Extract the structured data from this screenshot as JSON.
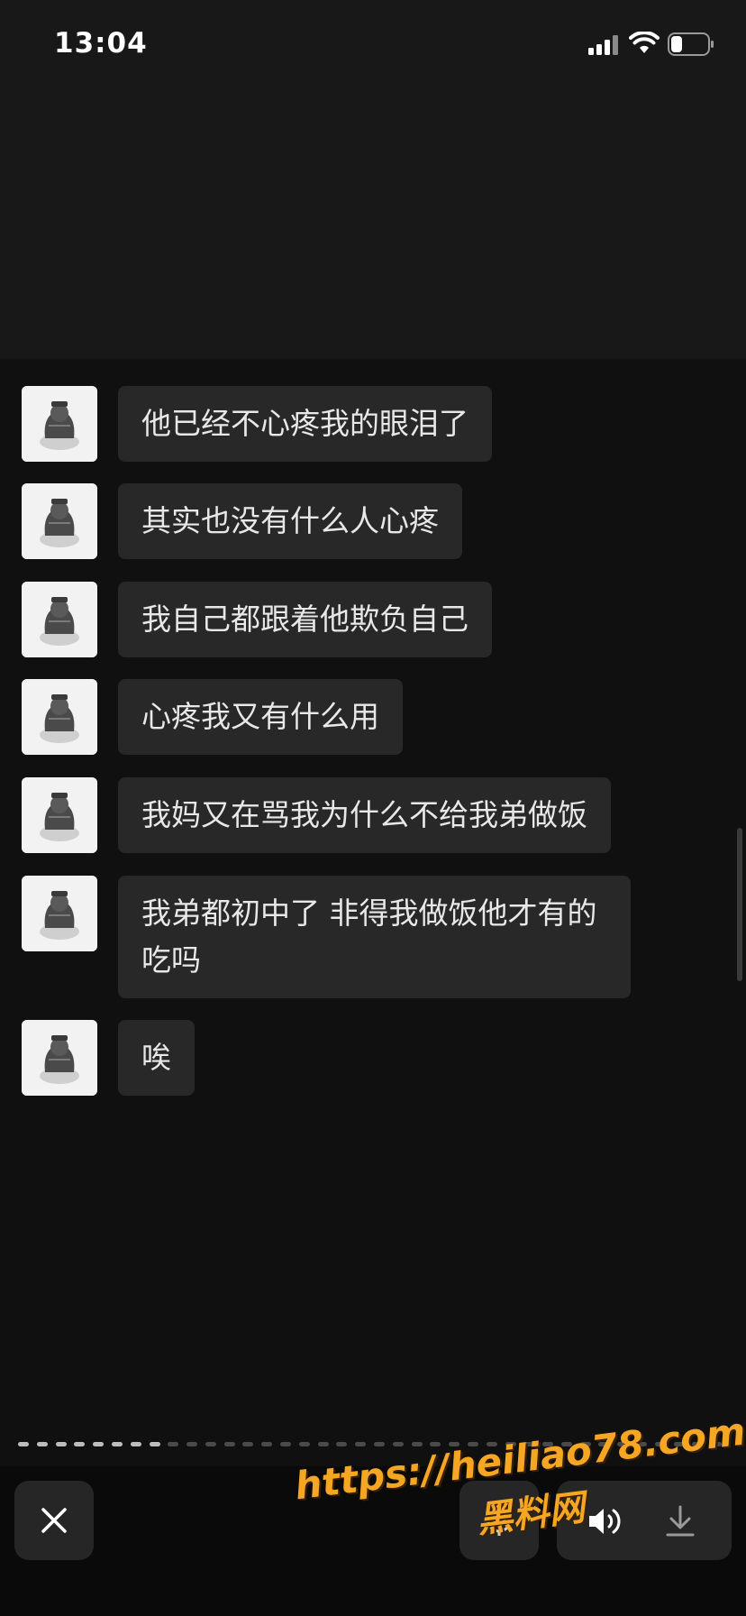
{
  "status_bar": {
    "time": "13:04",
    "icons": [
      "signal-icon",
      "wifi-icon",
      "battery-icon"
    ]
  },
  "messages": [
    {
      "text": "他已经不心疼我的眼泪了"
    },
    {
      "text": "其实也没有什么人心疼"
    },
    {
      "text": "我自己都跟着他欺负自己"
    },
    {
      "text": "心疼我又有什么用"
    },
    {
      "text": "我妈又在骂我为什么不给我弟做饭"
    },
    {
      "text": "我弟都初中了 非得我做饭他才有的吃吗"
    },
    {
      "text": "唉"
    }
  ],
  "progress": {
    "total_segments": 38,
    "viewed_segments": 8,
    "viewed_color": "#bdbdbd",
    "remaining_color": "#4a4a4a"
  },
  "toolbar": {
    "icons": [
      "close-icon",
      "mic-icon",
      "speaker-icon",
      "download-icon"
    ]
  },
  "watermark": {
    "url": "https://heiliao78.com",
    "name": "黑料网"
  },
  "colors": {
    "background": "#101010",
    "bubble": "#282828",
    "bubble_text": "#e8e8e8",
    "watermark": "#f5a623"
  }
}
